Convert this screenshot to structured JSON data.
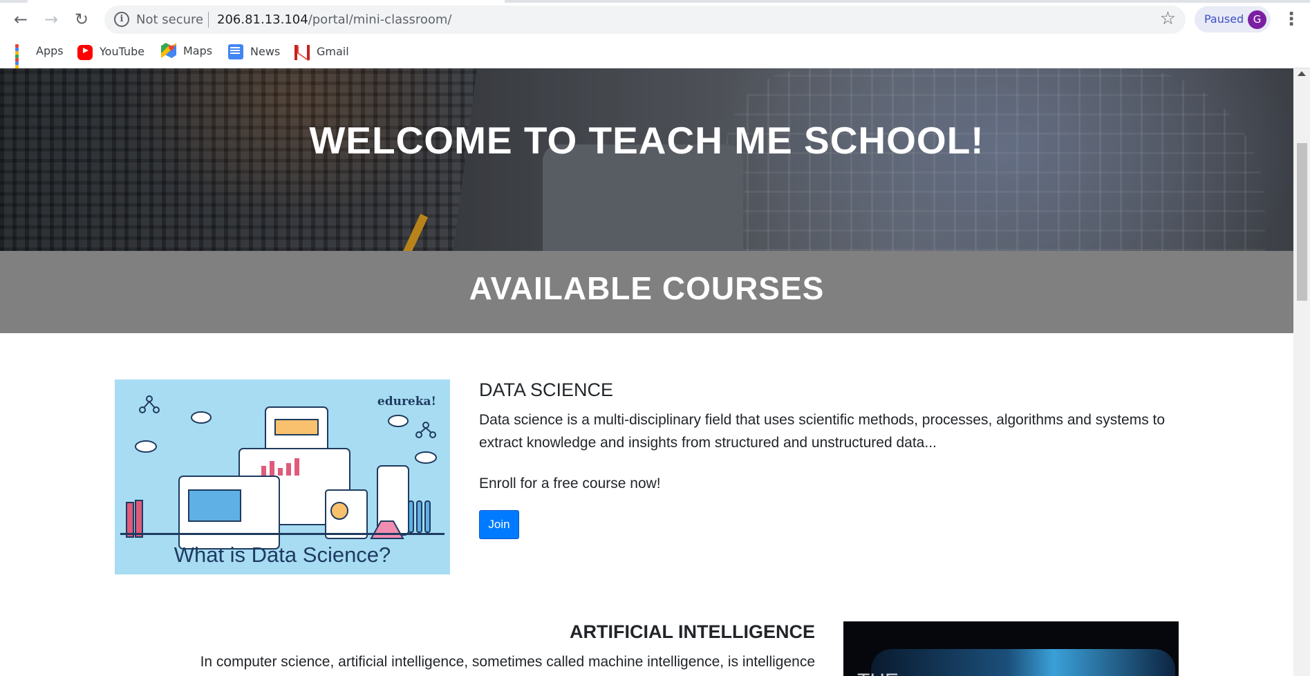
{
  "browser": {
    "nav": {
      "back_icon": "arrow-left-icon",
      "forward_icon": "arrow-right-icon",
      "reload_icon": "reload-icon"
    },
    "address_bar": {
      "security_label": "Not secure",
      "url_host": "206.81.13.104",
      "url_path": "/portal/mini-classroom/"
    },
    "profile": {
      "status": "Paused",
      "avatar_letter": "G",
      "avatar_color": "#7b1fa2"
    },
    "bookmarks": [
      {
        "label": "Apps",
        "icon": "apps-grid-icon"
      },
      {
        "label": "YouTube",
        "icon": "youtube-icon"
      },
      {
        "label": "Maps",
        "icon": "maps-icon"
      },
      {
        "label": "News",
        "icon": "news-icon"
      },
      {
        "label": "Gmail",
        "icon": "gmail-icon"
      }
    ]
  },
  "page": {
    "hero_title": "WELCOME TO TEACH ME SCHOOL!",
    "section_title": "AVAILABLE COURSES",
    "courses": [
      {
        "title": "DATA SCIENCE",
        "description": "Data science is a multi-disciplinary field that uses scientific methods, processes, algorithms and systems to extract knowledge and insights from structured and unstructured data...",
        "cta": "Enroll for a free course now!",
        "button": "Join",
        "image_caption": "What is Data Science?",
        "image_brand": "edureka!"
      },
      {
        "title": "ARTIFICIAL INTELLIGENCE",
        "description": "In computer science, artificial intelligence, sometimes called machine intelligence, is intelligence",
        "image_text": "THE"
      }
    ]
  },
  "colors": {
    "accent": "#007bff",
    "band": "#808080",
    "text": "#212529"
  }
}
